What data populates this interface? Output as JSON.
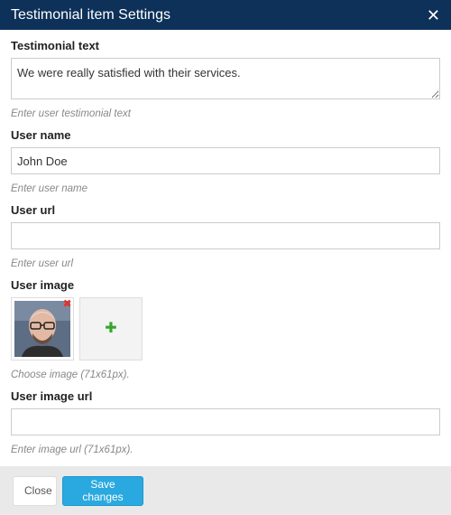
{
  "modal": {
    "title": "Testimonial item Settings",
    "close_icon": "close-icon"
  },
  "fields": {
    "testimonial_text": {
      "label": "Testimonial text",
      "value": "We were really satisfied with their services.",
      "help": "Enter user testimonial text"
    },
    "user_name": {
      "label": "User name",
      "value": "John Doe",
      "help": "Enter user name"
    },
    "user_url": {
      "label": "User url",
      "value": "",
      "help": "Enter user url"
    },
    "user_image": {
      "label": "User image",
      "help": "Choose image (71x61px).",
      "remove_icon": "remove-icon",
      "add_icon": "plus-icon"
    },
    "user_image_url": {
      "label": "User image url",
      "value": "",
      "help": "Enter image url (71x61px)."
    }
  },
  "footer": {
    "close_label": "Close",
    "save_label": "Save changes"
  },
  "colors": {
    "header_bg": "#0d3159",
    "save_button": "#29a9e0",
    "remove_icon": "#e0332a",
    "add_icon": "#35a52d"
  }
}
